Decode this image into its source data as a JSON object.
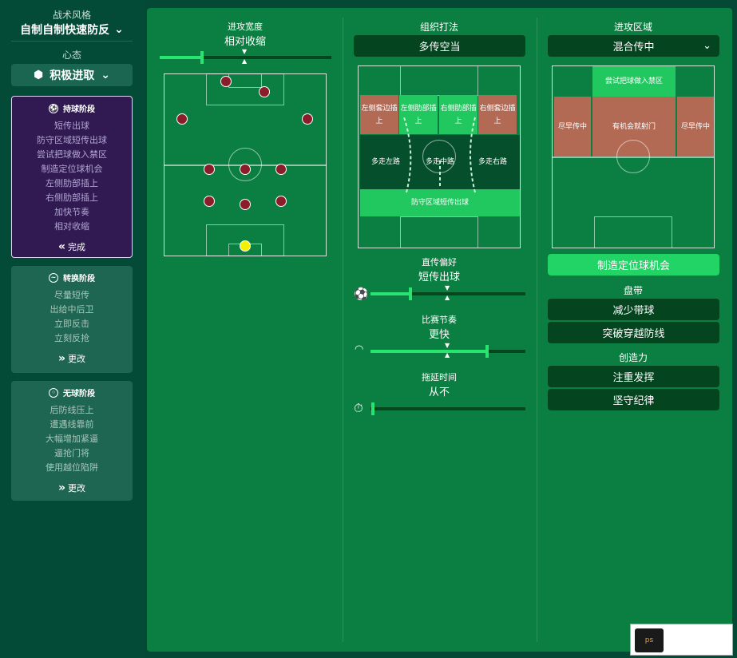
{
  "sidebar": {
    "style_title": "战术风格",
    "style_value": "自制自制快速防反",
    "mentality_title": "心态",
    "mentality_value": "积极进取",
    "in_possession": {
      "title": "持球阶段",
      "items": [
        "短传出球",
        "防守区域短传出球",
        "尝试把球做入禁区",
        "制造定位球机会",
        "左侧肋部插上",
        "右侧肋部插上",
        "加快节奏",
        "相对收缩"
      ],
      "button": "完成"
    },
    "transition": {
      "title": "转换阶段",
      "items": [
        "尽量短传",
        "出给中后卫",
        "立即反击",
        "立刻反抢"
      ],
      "button": "更改"
    },
    "out_possession": {
      "title": "无球阶段",
      "items": [
        "后防线压上",
        "遭遇线靠前",
        "大幅增加紧逼",
        "逼抢门将",
        "使用越位陷阱"
      ],
      "button": "更改"
    }
  },
  "width": {
    "title": "进攻宽度",
    "value": "相对收缩"
  },
  "build": {
    "title": "组织打法",
    "dropdown": "多传空当",
    "zones": {
      "left_wing": "左侧套边插上",
      "left_hs": "左侧肋部插上",
      "right_hs": "右侧肋部插上",
      "right_wing": "右侧套边插上",
      "left_channel": "多走左路",
      "center_channel": "多走中路",
      "right_channel": "多走右路",
      "def_short": "防守区域短传出球"
    },
    "passing": {
      "title": "直传偏好",
      "value": "短传出球"
    },
    "tempo": {
      "title": "比赛节奏",
      "value": "更快"
    },
    "time_wasting": {
      "title": "拖延时间",
      "value": "从不"
    },
    "passing_level": 0.25,
    "tempo_level": 0.75,
    "time_wasting_level": 0.0
  },
  "attack": {
    "title": "进攻区域",
    "dropdown": "混合传中",
    "zones": {
      "box": "尝试把球做入禁区",
      "left_early": "尽早传中",
      "shoot": "有机会就射门",
      "right_early": "尽早传中"
    },
    "set_piece_button": "制造定位球机会",
    "dribble_title": "盘带",
    "dribble_1": "减少带球",
    "dribble_2": "突破穿越防线",
    "creative_title": "创造力",
    "creative_1": "注重发挥",
    "creative_2": "坚守纪律"
  },
  "watermark": {
    "text": "ps"
  },
  "colors": {
    "accent": "#2be36f",
    "panel": "#0b7f41",
    "sidebar": "#034a37",
    "active_phase": "#311a52",
    "player": "#8b1d2b",
    "gk": "#f3f000"
  }
}
